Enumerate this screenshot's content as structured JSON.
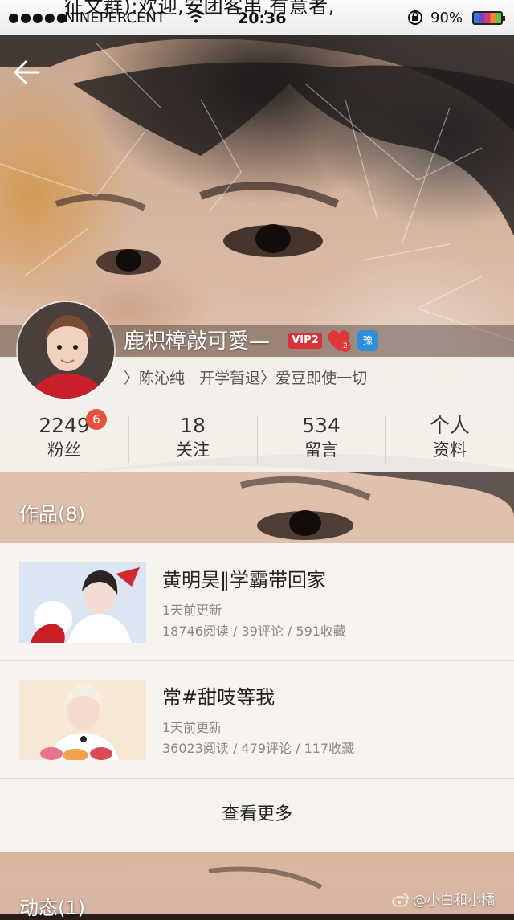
{
  "status_bar": {
    "overlay_text": "征文群):欢迎,安团客串,有意者,",
    "signal": "●●●●●",
    "carrier": "NINEPERCENT",
    "time": "20:36",
    "battery": "90%"
  },
  "profile": {
    "username": "鹿枳樟敲可愛—",
    "vip_badge": "VIP2",
    "heart_count": "2",
    "blue_badge": "豫",
    "bio": "〉陈沁纯   开学暂退〉爱豆即使一切"
  },
  "stats": [
    {
      "value": "2249",
      "label": "粉丝"
    },
    {
      "value": "18",
      "label": "关注"
    },
    {
      "value": "534",
      "label": "留言"
    },
    {
      "value": "个人",
      "label": "资料"
    }
  ],
  "fans_badge": "6",
  "works": {
    "title": "作品(8)",
    "items": [
      {
        "title": "黄明昊‖学霸带回家",
        "updated": "1天前更新",
        "stats": "18746阅读 / 39评论 / 591收藏"
      },
      {
        "title": "常#甜吱等我",
        "updated": "1天前更新",
        "stats": "36023阅读 / 479评论 / 117收藏"
      }
    ],
    "more": "查看更多"
  },
  "activity": {
    "title": "动态(1)"
  },
  "watermark": "@小白和小橘",
  "colors": {
    "vip": "#d8323b",
    "badge": "#e4513e",
    "blue_badge": "#2f8fd6"
  }
}
